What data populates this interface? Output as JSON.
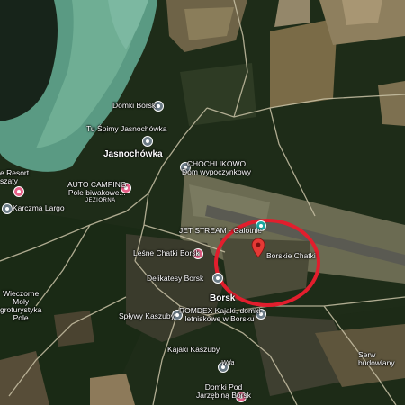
{
  "map": {
    "marker_color": "#e53935",
    "highlight_circle_color": "#e21e2d",
    "labels": {
      "domki_borsk_top": "Domki Borsk",
      "tu_spimy": "Tu Śpimy Jasnochówka",
      "jasnochowka": "Jasnochówka",
      "chochlikowo": "CHOCHLIKOWO\nDom wypoczynkowy",
      "resort": "e Resort\nszaty",
      "auto_camping": "AUTO CAMPING\nPole biwakowe...",
      "jeziorna": "JEZIORNA",
      "karczma": "Karczma Largo",
      "jet_stream": "JET STREAM - Galotnie",
      "borskie_chatki": "Borskie Chatki",
      "lesne_chatki": "Leśne Chatki Borsk",
      "delikatesy": "Delikatesy Borsk",
      "borsk": "Borsk",
      "wieczorne": "Wieczorne\nMoły\ngroturystyka\nPole",
      "splywy": "Spływy Kaszuby",
      "romdex": "ROMDEX Kajaki, domki\nletniskowe w Borsku",
      "kajaki": "Kajaki Kaszuby",
      "wda": "Wda",
      "domki_pod": "Domki Pod\nJarzębiną Borsk",
      "serw": "Serw\nbudowlany"
    }
  }
}
